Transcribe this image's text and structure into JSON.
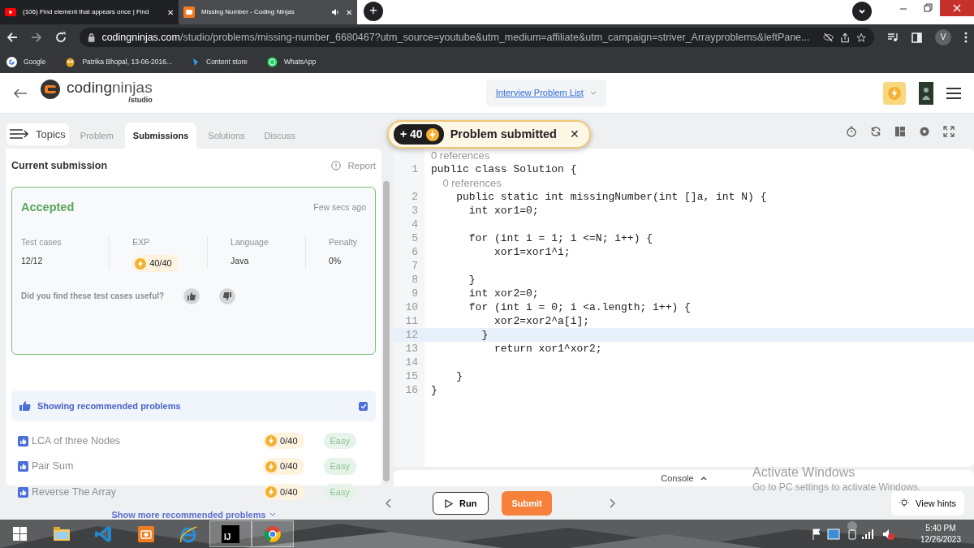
{
  "browser": {
    "tabs": [
      {
        "title": "(106) Find element that appears once | Find",
        "kind": "video",
        "selected": false,
        "close": "✕"
      },
      {
        "title": "Missing Number - Coding Ninjas",
        "kind": "site",
        "selected": true,
        "close": "✕"
      }
    ],
    "new_tab": "+",
    "url_domain": "codingninjas.com",
    "url_path": "/studio/problems/missing-number_6680467?utm_source=youtube&utm_medium=affiliate&utm_campaign=striver_Arrayproblems&leftPane...",
    "profile": "V",
    "bookmarks": [
      {
        "label": "Google",
        "kind": "google"
      },
      {
        "label": "Patrika Bhopal, 13-06-2016...",
        "kind": "owl"
      },
      {
        "label": "Content store",
        "kind": "store"
      },
      {
        "label": "WhatsApp",
        "kind": "whatsapp"
      }
    ]
  },
  "header": {
    "logo_a": "coding",
    "logo_b": "ninjas",
    "logo_sub": "/studio",
    "problem_list": "Interview Problem List"
  },
  "topics": "Topics",
  "panel_tabs": [
    {
      "label": "Problem",
      "selected": false
    },
    {
      "label": "Submissions",
      "selected": true
    },
    {
      "label": "Solutions",
      "selected": false
    },
    {
      "label": "Discuss",
      "selected": false
    }
  ],
  "submission": {
    "heading": "Current submission",
    "report": "Report",
    "status": "Accepted",
    "time": "Few secs ago",
    "stats": [
      {
        "label": "Test cases",
        "value": "12/12",
        "kind": "text"
      },
      {
        "label": "EXP",
        "value": "40/40",
        "kind": "exp"
      },
      {
        "label": "Language",
        "value": "Java",
        "kind": "text"
      },
      {
        "label": "Penalty",
        "value": "0%",
        "kind": "text"
      }
    ],
    "feedback": "Did you find these test cases useful?"
  },
  "recommended": {
    "label": "Showing recommended problems",
    "checked": true,
    "problems": [
      {
        "title": "LCA of three Nodes",
        "exp": "0/40",
        "difficulty": "Easy"
      },
      {
        "title": "Pair Sum",
        "exp": "0/40",
        "difficulty": "Easy"
      },
      {
        "title": "Reverse The Array",
        "exp": "0/40",
        "difficulty": "Easy"
      }
    ],
    "more": "Show more recommended problems"
  },
  "toast": {
    "points": "+ 40",
    "message": "Problem submitted",
    "close": "✕"
  },
  "editor": {
    "lines": [
      {
        "kind": "lens",
        "text": "0 references"
      },
      {
        "kind": "code",
        "number": "1",
        "text": "public class Solution {",
        "current": false
      },
      {
        "kind": "lens",
        "text": "    0 references"
      },
      {
        "kind": "code",
        "number": "2",
        "text": "    public static int missingNumber(int []a, int N) {",
        "current": false
      },
      {
        "kind": "code",
        "number": "3",
        "text": "      int xor1=0;",
        "current": false
      },
      {
        "kind": "code",
        "number": "4",
        "current": false
      },
      {
        "kind": "code",
        "number": "5",
        "text": "      for (int i = 1; i <=N; i++) {",
        "current": false
      },
      {
        "kind": "code",
        "number": "6",
        "text": "          xor1=xor1^i;",
        "current": false
      },
      {
        "kind": "code",
        "number": "7",
        "current": false
      },
      {
        "kind": "code",
        "number": "8",
        "text": "      }",
        "current": false
      },
      {
        "kind": "code",
        "number": "9",
        "text": "      int xor2=0;",
        "current": false
      },
      {
        "kind": "code",
        "number": "10",
        "text": "      for (int i = 0; i <a.length; i++) {",
        "current": false
      },
      {
        "kind": "code",
        "number": "11",
        "text": "          xor2=xor2^a[i];",
        "current": false
      },
      {
        "kind": "code",
        "number": "12",
        "text": "        }",
        "current": true
      },
      {
        "kind": "code",
        "number": "13",
        "text": "          return xor1^xor2;",
        "current": false
      },
      {
        "kind": "code",
        "number": "14",
        "current": false
      },
      {
        "kind": "code",
        "number": "15",
        "text": "    }",
        "current": false
      },
      {
        "kind": "code",
        "number": "16",
        "text": "}",
        "current": false
      }
    ]
  },
  "console": "Console",
  "actions": {
    "run": "Run",
    "submit": "Submit",
    "hints": "View hints"
  },
  "os_notice": {
    "title": "Activate Windows",
    "hint": "Go to PC settings to activate Windows."
  },
  "taskbar": {
    "apps": [
      {
        "kind": "start",
        "running": false
      },
      {
        "kind": "files",
        "running": false
      },
      {
        "kind": "vscode",
        "running": false
      },
      {
        "kind": "camera",
        "running": false
      },
      {
        "kind": "ie",
        "running": false
      },
      {
        "kind": "intellij",
        "label": "IJ",
        "running": true
      },
      {
        "kind": "chrome",
        "running": true
      }
    ],
    "time": "5:40 PM",
    "date": "12/26/2023"
  }
}
